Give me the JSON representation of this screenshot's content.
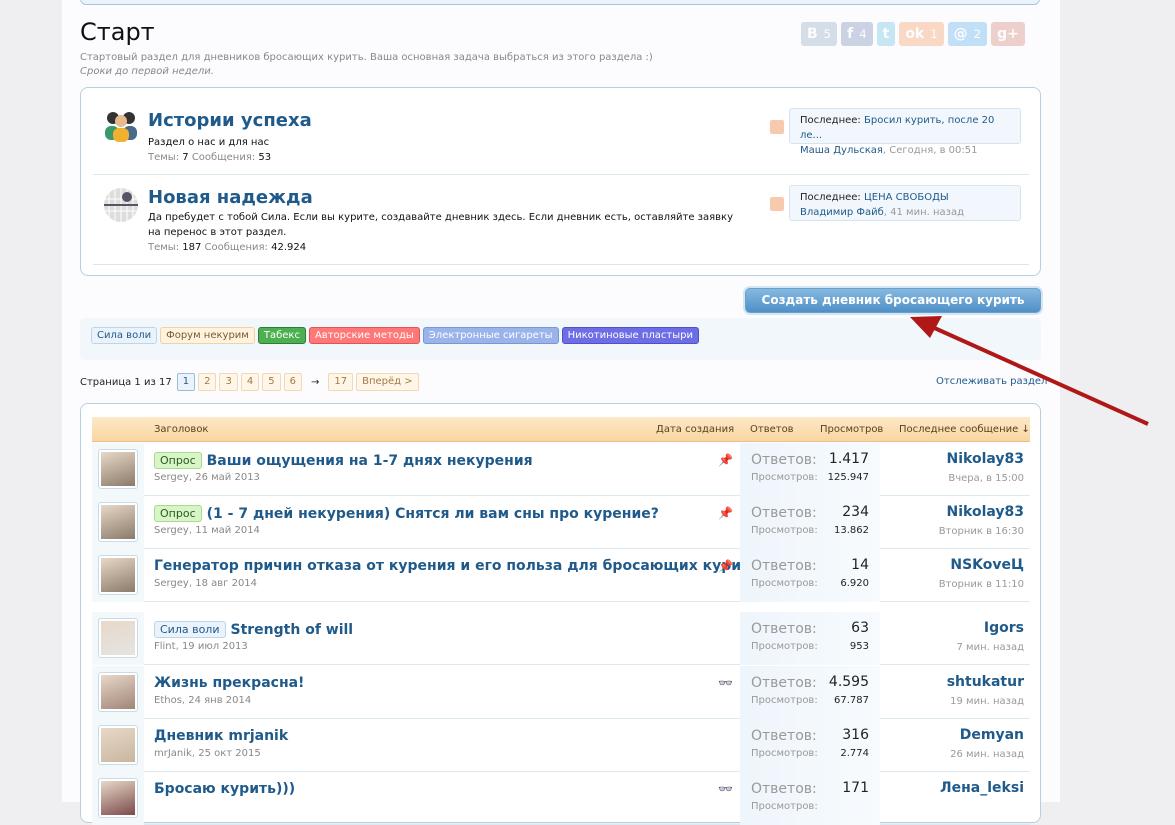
{
  "page": {
    "title": "Старт",
    "description": "Стартовый раздел для дневников бросающих курить. Ваша основная задача выбраться из этого раздела :)",
    "note": "Сроки до первой недели."
  },
  "share": [
    {
      "icon": "vk-icon",
      "label": "В",
      "count": "5",
      "color": "#6383a8"
    },
    {
      "icon": "facebook-icon",
      "label": "f",
      "count": "4",
      "color": "#3b5998"
    },
    {
      "icon": "twitter-icon",
      "label": "t",
      "count": "",
      "color": "#2ca8d2"
    },
    {
      "icon": "odnoklassniki-icon",
      "label": "ok",
      "count": "1",
      "color": "#f4731c"
    },
    {
      "icon": "mailru-icon",
      "label": "@",
      "count": "2",
      "color": "#168de2"
    },
    {
      "icon": "googleplus-icon",
      "label": "g+",
      "count": "",
      "color": "#c25234"
    }
  ],
  "nodes": [
    {
      "title": "Истории успеха",
      "desc": "Раздел о нас и для нас",
      "threads_label": "Темы:",
      "threads": "7",
      "posts_label": "Сообщения:",
      "posts": "53",
      "last_label": "Последнее:",
      "last_title": "Бросил курить, после 20 ле...",
      "last_user": "Маша Дульская",
      "last_time": "Сегодня, в 00:51"
    },
    {
      "title": "Новая надежда",
      "desc": "Да пребудет с тобой Сила. Если вы курите, создавайте дневник здесь. Если дневник есть, оставляйте заявку на перенос в этот раздел.",
      "threads_label": "Темы:",
      "threads": "187",
      "posts_label": "Сообщения:",
      "posts": "42.924",
      "last_label": "Последнее:",
      "last_title": "ЦЕНА СВОБОДЫ",
      "last_user": "Владимир Файб",
      "last_time": "41 мин. назад"
    }
  ],
  "create_button": "Создать дневник бросающего курить",
  "prefixes": [
    {
      "label": "Сила воли",
      "bg": "#eaf3fb",
      "border": "#bcd6e8",
      "color": "#1f5a8a"
    },
    {
      "label": "Форум некурим",
      "bg": "#fff3e0",
      "border": "#f0d2a4",
      "color": "#7a5a30"
    },
    {
      "label": "Табекс",
      "bg": "#4caf50",
      "border": "#2e7d32",
      "color": "#ffffff"
    },
    {
      "label": "Авторские методы",
      "bg": "#f77",
      "border": "#d55",
      "color": "#ffffff"
    },
    {
      "label": "Электронные сигареты",
      "bg": "#9ab3ea",
      "border": "#7a96d2",
      "color": "#ffffff"
    },
    {
      "label": "Никотиновые пластыри",
      "bg": "#6d6de6",
      "border": "#5050c8",
      "color": "#ffffff"
    }
  ],
  "pager": {
    "label": "Страница 1 из 17",
    "pages": [
      "1",
      "2",
      "3",
      "4",
      "5",
      "6"
    ],
    "arrow": "→",
    "last": "17",
    "next": "Вперёд >"
  },
  "watch": "Отслеживать раздел",
  "columns": {
    "title": "Заголовок",
    "created": "Дата создания",
    "replies": "Ответов",
    "views": "Просмотров",
    "last": "Последнее сообщение ↓"
  },
  "stat_labels": {
    "replies": "Ответов:",
    "views": "Просмотров:"
  },
  "threads": [
    {
      "prefix": "Опрос",
      "title": "Ваши ощущения на 1-7 днях некурения",
      "author": "Sergey",
      "date": "26 май 2013",
      "flag": "📌",
      "replies": "1.417",
      "views": "125.947",
      "last_user": "Nikolay83",
      "last_date": "Вчера, в 15:00",
      "avatar": "#8a7a6a"
    },
    {
      "prefix": "Опрос",
      "title": "(1 - 7 дней некурения) Снятся ли вам сны про курение?",
      "author": "Sergey",
      "date": "11 май 2014",
      "flag": "📌",
      "replies": "234",
      "views": "13.862",
      "last_user": "Nikolay83",
      "last_date": "Вторник в 16:30",
      "avatar": "#8a7a6a"
    },
    {
      "prefix": "",
      "title": "Генератор причин отказа от курения и его польза для бросающих курить",
      "author": "Sergey",
      "date": "18 авг 2014",
      "flag": "📌",
      "replies": "14",
      "views": "6.920",
      "last_user": "NSKoveЦ",
      "last_date": "Вторник в 11:10",
      "avatar": "#8a7a6a"
    },
    {
      "prefix": "Сила воли",
      "title": "Strength of will",
      "author": "Flint",
      "date": "19 июл 2013",
      "flag": "",
      "replies": "63",
      "views": "953",
      "last_user": "Igors",
      "last_date": "7 мин. назад",
      "avatar": "#e4e4e4"
    },
    {
      "prefix": "",
      "title": "Жизнь прекрасна!",
      "author": "Ethos",
      "date": "24 янв 2014",
      "flag": "👓",
      "replies": "4.595",
      "views": "67.787",
      "last_user": "shtukatur",
      "last_date": "19 мин. назад",
      "avatar": "#a08478"
    },
    {
      "prefix": "",
      "title": "Дневник mrjanik",
      "author": "mrJanik",
      "date": "25 окт 2015",
      "flag": "",
      "replies": "316",
      "views": "2.774",
      "last_user": "Demyan",
      "last_date": "26 мин. назад",
      "avatar": "#c8b6a0"
    },
    {
      "prefix": "",
      "title": "Бросаю курить)))",
      "author": "",
      "date": "",
      "flag": "👓",
      "replies": "171",
      "views": "",
      "last_user": "Лена_leksi",
      "last_date": "",
      "avatar": "#7a4a4a"
    }
  ]
}
